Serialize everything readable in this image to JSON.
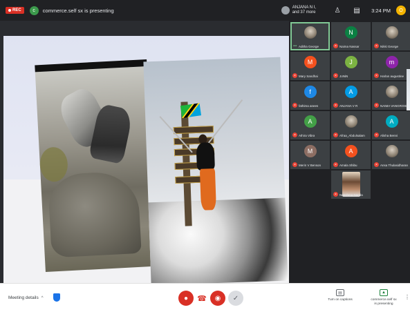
{
  "topbar": {
    "rec_label": "REC",
    "presenter_initial": "c",
    "presenter_text": "commerce.self sx is presenting",
    "participants_line1": "ANJANA N I,",
    "participants_line2": "and 37 more",
    "people_icon": "people-icon",
    "chat_icon": "chat-icon",
    "time": "3:24 PM",
    "self_initial": "O",
    "colors": {
      "bar": "#202124",
      "rec": "#d93025"
    }
  },
  "tiles": [
    {
      "name": "Aditha George",
      "type": "photo",
      "speaking": true
    },
    {
      "name": "Naima Nassar",
      "initial": "N",
      "color": "#0b8043"
    },
    {
      "name": "Nikki George",
      "type": "photo"
    },
    {
      "name": "Mary Sandhai",
      "initial": "M",
      "color": "#f4511e"
    },
    {
      "name": "JoNiN",
      "initial": "J",
      "color": "#7cb342"
    },
    {
      "name": "Harlan augustine",
      "initial": "m",
      "color": "#8e24aa"
    },
    {
      "name": "fathima anees",
      "initial": "f",
      "color": "#1e88e5"
    },
    {
      "name": "ANJANA V R",
      "initial": "A",
      "color": "#039be5"
    },
    {
      "name": "NAIMA VANGROSE",
      "type": "photo"
    },
    {
      "name": "Athira Vibra",
      "initial": "A",
      "color": "#43a047"
    },
    {
      "name": "Afraa_Abdulsalam",
      "type": "photo"
    },
    {
      "name": "Alisha Benni",
      "initial": "A",
      "color": "#00acc1"
    },
    {
      "name": "Merin V Benson",
      "initial": "M",
      "color": "#8d6e63"
    },
    {
      "name": "Amala Shibu",
      "initial": "A",
      "color": "#f4511e"
    },
    {
      "name": "Ansa Thulasidharan",
      "type": "photo"
    },
    {
      "name": "Neeshma Nanda",
      "type": "photo",
      "big": true
    }
  ],
  "bottombar": {
    "meeting_details": "Meeting details",
    "captions_label": "Turn on captions",
    "present_label_1": "commerce.self sx",
    "present_label_2": "is presenting",
    "mic_icon": "mic-off-icon",
    "hangup_icon": "hangup-icon",
    "camera_icon": "camera-off-icon",
    "check_icon": "check-icon"
  }
}
